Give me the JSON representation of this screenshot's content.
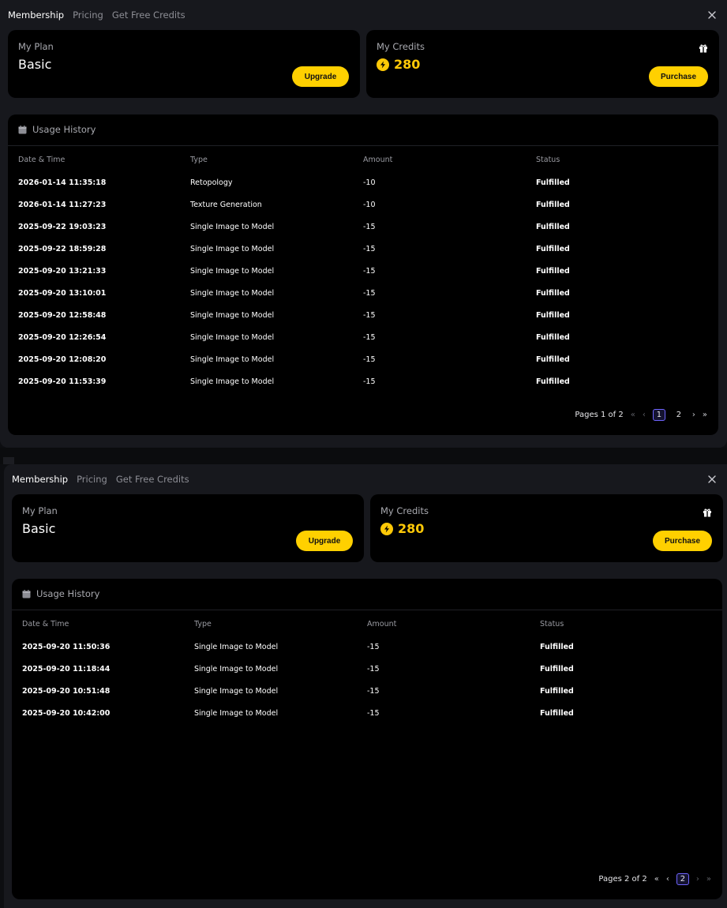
{
  "tabs": [
    "Membership",
    "Pricing",
    "Get Free Credits"
  ],
  "plan": {
    "label": "My Plan",
    "name": "Basic",
    "upgrade": "Upgrade"
  },
  "credits": {
    "label": "My Credits",
    "value": "280",
    "purchase": "Purchase"
  },
  "history": {
    "title": "Usage History",
    "columns": [
      "Date & Time",
      "Type",
      "Amount",
      "Status"
    ]
  },
  "pages": [
    {
      "pager_text": "Pages 1 of 2",
      "pages": [
        "1",
        "2"
      ],
      "current": "1",
      "rows": [
        [
          "2026-01-14 11:35:18",
          "Retopology",
          "-10",
          "Fulfilled"
        ],
        [
          "2026-01-14 11:27:23",
          "Texture Generation",
          "-10",
          "Fulfilled"
        ],
        [
          "2025-09-22 19:03:23",
          "Single Image to Model",
          "-15",
          "Fulfilled"
        ],
        [
          "2025-09-22 18:59:28",
          "Single Image to Model",
          "-15",
          "Fulfilled"
        ],
        [
          "2025-09-20 13:21:33",
          "Single Image to Model",
          "-15",
          "Fulfilled"
        ],
        [
          "2025-09-20 13:10:01",
          "Single Image to Model",
          "-15",
          "Fulfilled"
        ],
        [
          "2025-09-20 12:58:48",
          "Single Image to Model",
          "-15",
          "Fulfilled"
        ],
        [
          "2025-09-20 12:26:54",
          "Single Image to Model",
          "-15",
          "Fulfilled"
        ],
        [
          "2025-09-20 12:08:20",
          "Single Image to Model",
          "-15",
          "Fulfilled"
        ],
        [
          "2025-09-20 11:53:39",
          "Single Image to Model",
          "-15",
          "Fulfilled"
        ]
      ]
    },
    {
      "pager_text": "Pages 2 of 2",
      "pages": [
        "2"
      ],
      "current": "2",
      "rows": [
        [
          "2025-09-20 11:50:36",
          "Single Image to Model",
          "-15",
          "Fulfilled"
        ],
        [
          "2025-09-20 11:18:44",
          "Single Image to Model",
          "-15",
          "Fulfilled"
        ],
        [
          "2025-09-20 10:51:48",
          "Single Image to Model",
          "-15",
          "Fulfilled"
        ],
        [
          "2025-09-20 10:42:00",
          "Single Image to Model",
          "-15",
          "Fulfilled"
        ]
      ]
    }
  ],
  "colors": {
    "accent": "#ffd000",
    "credit": "#ffc907",
    "page_border": "#6f65ff"
  },
  "icons": [
    "close-icon",
    "gift-icon",
    "lightning-icon",
    "calendar-icon",
    "first-page-icon",
    "prev-page-icon",
    "next-page-icon",
    "last-page-icon"
  ]
}
